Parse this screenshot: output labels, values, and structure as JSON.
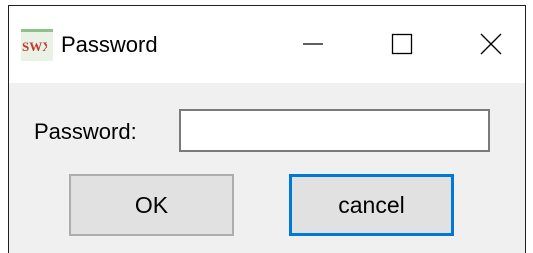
{
  "window": {
    "title": "Password",
    "app_icon": "swx-app-icon",
    "controls": {
      "minimize_icon": "minimize-icon",
      "maximize_icon": "maximize-icon",
      "close_icon": "close-icon"
    }
  },
  "form": {
    "password_label": "Password:",
    "password_value": "",
    "ok_label": "OK",
    "cancel_label": "cancel"
  },
  "colors": {
    "focus_border": "#0078d7",
    "dialog_background": "#f0f0f0",
    "button_background": "#e1e1e1"
  }
}
